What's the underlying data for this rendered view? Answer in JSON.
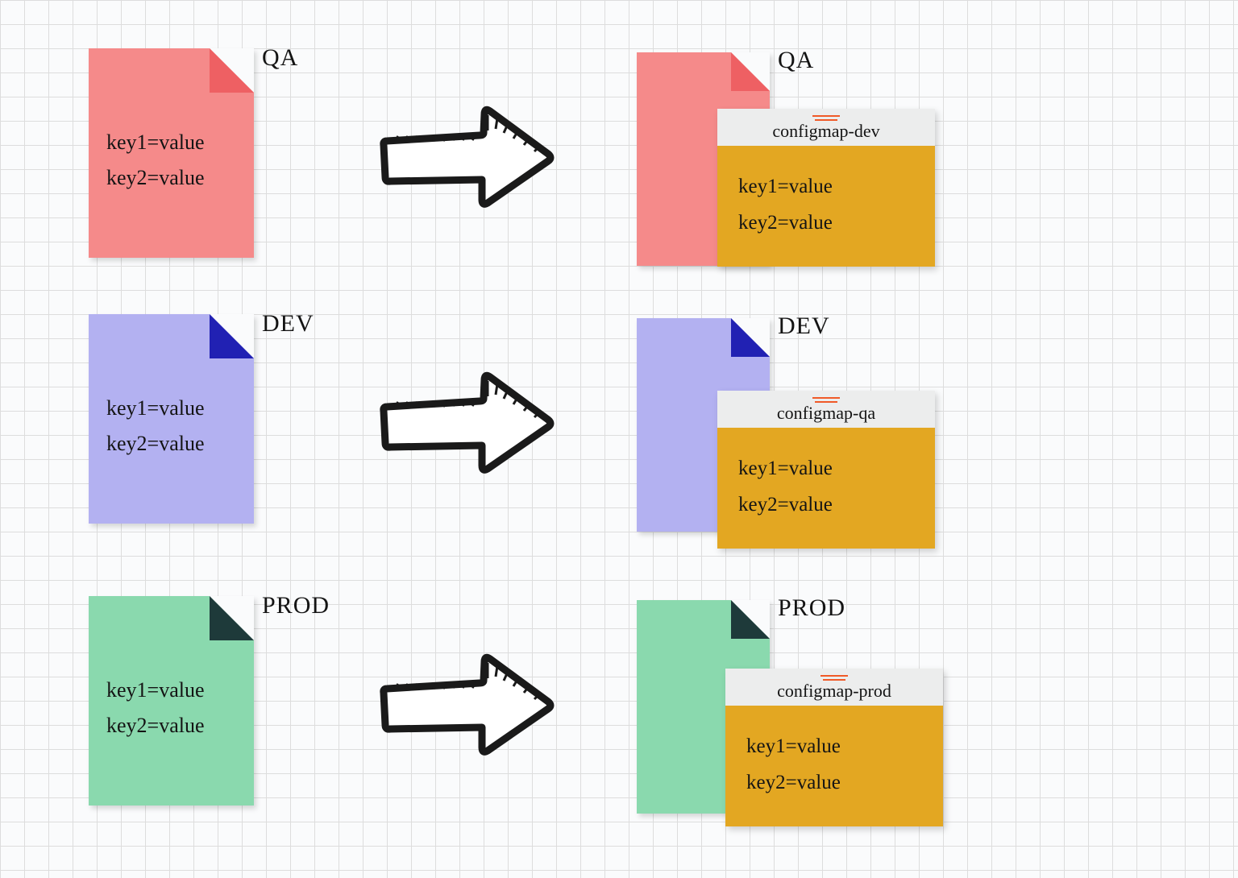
{
  "rows": [
    {
      "env_label": "QA",
      "source_lines": {
        "l1": "key1=value",
        "l2": "key2=value"
      },
      "right_label": "QA",
      "configmap": {
        "title": "configmap-dev",
        "lines": {
          "l1": "key1=value",
          "l2": "key2=value"
        }
      }
    },
    {
      "env_label": "DEV",
      "source_lines": {
        "l1": "key1=value",
        "l2": "key2=value"
      },
      "right_label": "DEV",
      "configmap": {
        "title": "configmap-qa",
        "lines": {
          "l1": "key1=value",
          "l2": "key2=value"
        }
      }
    },
    {
      "env_label": "PROD",
      "source_lines": {
        "l1": "key1=value",
        "l2": "key2=value"
      },
      "right_label": "PROD",
      "configmap": {
        "title": "configmap-prod",
        "lines": {
          "l1": "key1=value",
          "l2": "key2=value"
        }
      }
    }
  ]
}
